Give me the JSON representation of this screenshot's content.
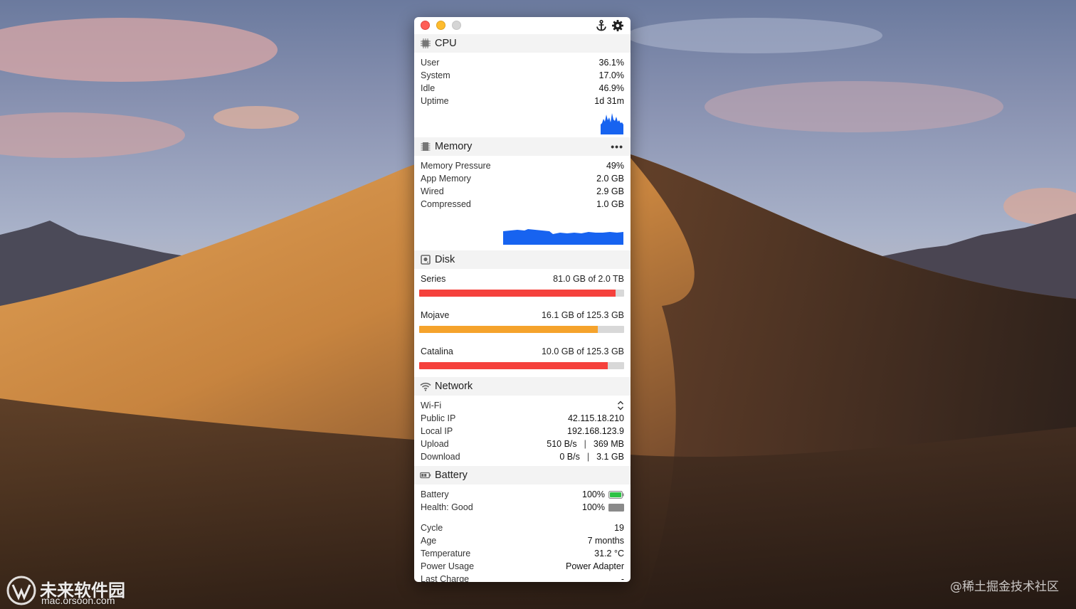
{
  "window": {
    "title_icons": [
      "anchor-icon",
      "gear-icon"
    ]
  },
  "cpu": {
    "title": "CPU",
    "rows": [
      {
        "label": "User",
        "value": "36.1%"
      },
      {
        "label": "System",
        "value": "17.0%"
      },
      {
        "label": "Idle",
        "value": "46.9%"
      },
      {
        "label": "Uptime",
        "value": "1d 31m"
      }
    ]
  },
  "memory": {
    "title": "Memory",
    "more": "•••",
    "rows": [
      {
        "label": "Memory Pressure",
        "value": "49%"
      },
      {
        "label": "App Memory",
        "value": "2.0 GB"
      },
      {
        "label": "Wired",
        "value": "2.9 GB"
      },
      {
        "label": "Compressed",
        "value": "1.0 GB"
      }
    ]
  },
  "disk": {
    "title": "Disk",
    "items": [
      {
        "name": "Series",
        "value": "81.0 GB of 2.0 TB",
        "used_fraction": 0.96,
        "color": "#f5413c"
      },
      {
        "name": "Mojave",
        "value": "16.1 GB of 125.3 GB",
        "used_fraction": 0.87,
        "color": "#f5a32c"
      },
      {
        "name": "Catalina",
        "value": "10.0 GB of 125.3 GB",
        "used_fraction": 0.92,
        "color": "#f5413c"
      }
    ]
  },
  "network": {
    "title": "Network",
    "interface": "Wi-Fi",
    "rows": [
      {
        "label": "Public IP",
        "value": "42.115.18.210"
      },
      {
        "label": "Local IP",
        "value": "192.168.123.9"
      }
    ],
    "upload": {
      "label": "Upload",
      "rate": "510 B/s",
      "sep": "|",
      "total": "369 MB"
    },
    "download": {
      "label": "Download",
      "rate": "0 B/s",
      "sep": "|",
      "total": "3.1 GB"
    }
  },
  "battery": {
    "title": "Battery",
    "level": {
      "label": "Battery",
      "value": "100%"
    },
    "health": {
      "label": "Health: Good",
      "value": "100%"
    },
    "rows": [
      {
        "label": "Cycle",
        "value": "19"
      },
      {
        "label": "Age",
        "value": "7 months"
      },
      {
        "label": "Temperature",
        "value": "31.2 °C"
      },
      {
        "label": "Power Usage",
        "value": "Power Adapter"
      },
      {
        "label": "Last Charge",
        "value": "-"
      }
    ],
    "level_color": "#2dc244"
  },
  "colors": {
    "graph_blue": "#1763f0",
    "accent_red": "#f5413c",
    "accent_orange": "#f5a32c"
  },
  "watermarks": {
    "left_main": "未来软件园",
    "left_sub": "mac.orsoon.com",
    "right": "@稀土掘金技术社区"
  }
}
